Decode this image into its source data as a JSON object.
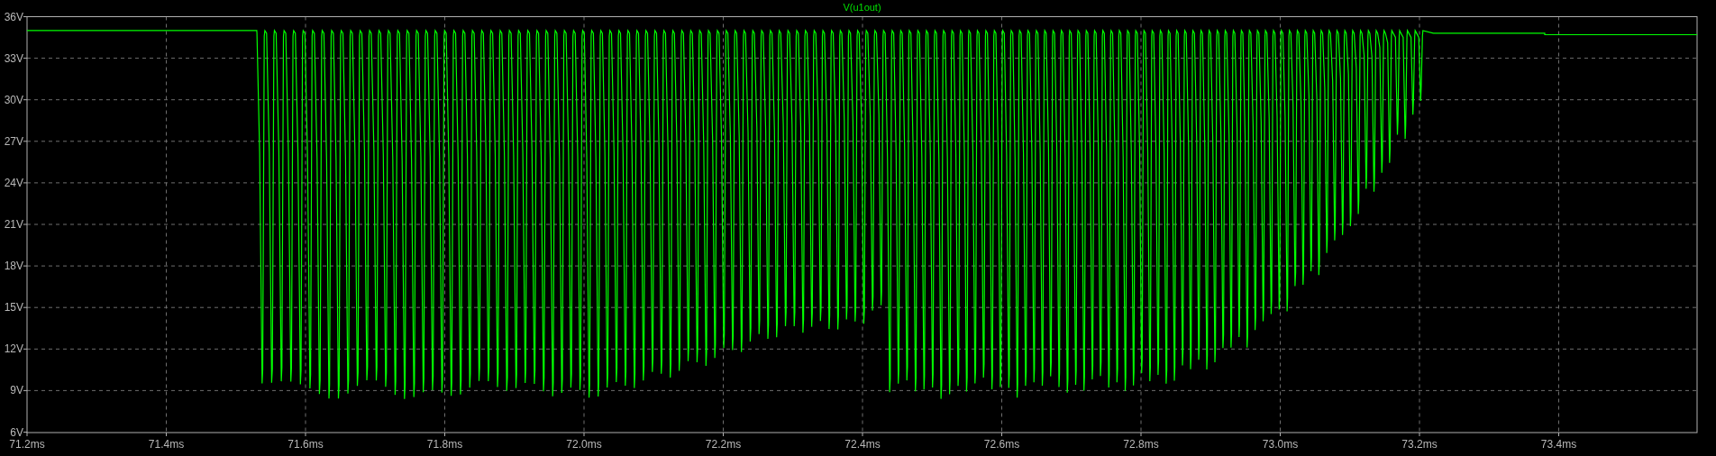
{
  "plot": {
    "trace_label": "V(u1out)",
    "y_ticks": [
      "36V",
      "33V",
      "30V",
      "27V",
      "24V",
      "21V",
      "18V",
      "15V",
      "12V",
      "9V",
      "6V"
    ],
    "x_ticks": [
      "71.2ms",
      "71.4ms",
      "71.6ms",
      "71.8ms",
      "72.0ms",
      "72.2ms",
      "72.4ms",
      "72.6ms",
      "72.8ms",
      "73.0ms",
      "73.2ms",
      "73.4ms"
    ]
  }
}
